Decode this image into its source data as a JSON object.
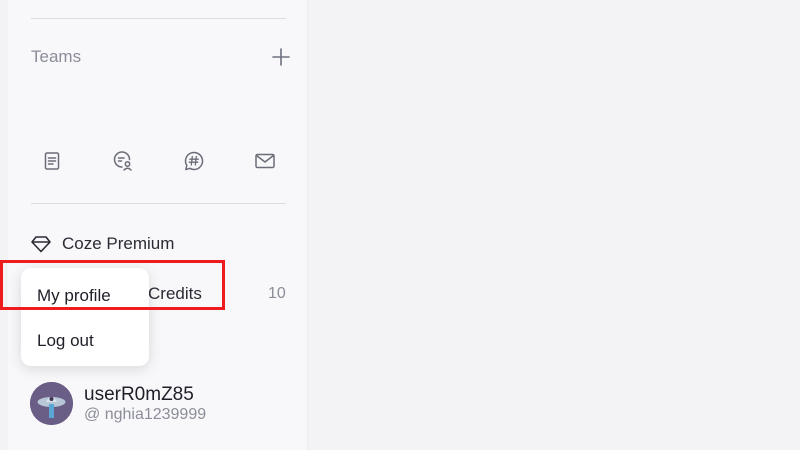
{
  "sidebar": {
    "teams_label": "Teams",
    "icons": [
      "document-icon",
      "chat-user-icon",
      "hashtag-chat-icon",
      "mail-icon"
    ],
    "premium_label": "Coze Premium",
    "credits_label": "Credits",
    "credits_count": "10"
  },
  "user": {
    "username": "userR0mZ85",
    "handle": "@ nghia1239999"
  },
  "dropdown": {
    "items": [
      "My profile",
      "Log out"
    ]
  },
  "colors": {
    "highlight": "#ee1c1c",
    "sidebar_bg": "#f8f8fa",
    "page_bg": "#f3f3f6"
  }
}
